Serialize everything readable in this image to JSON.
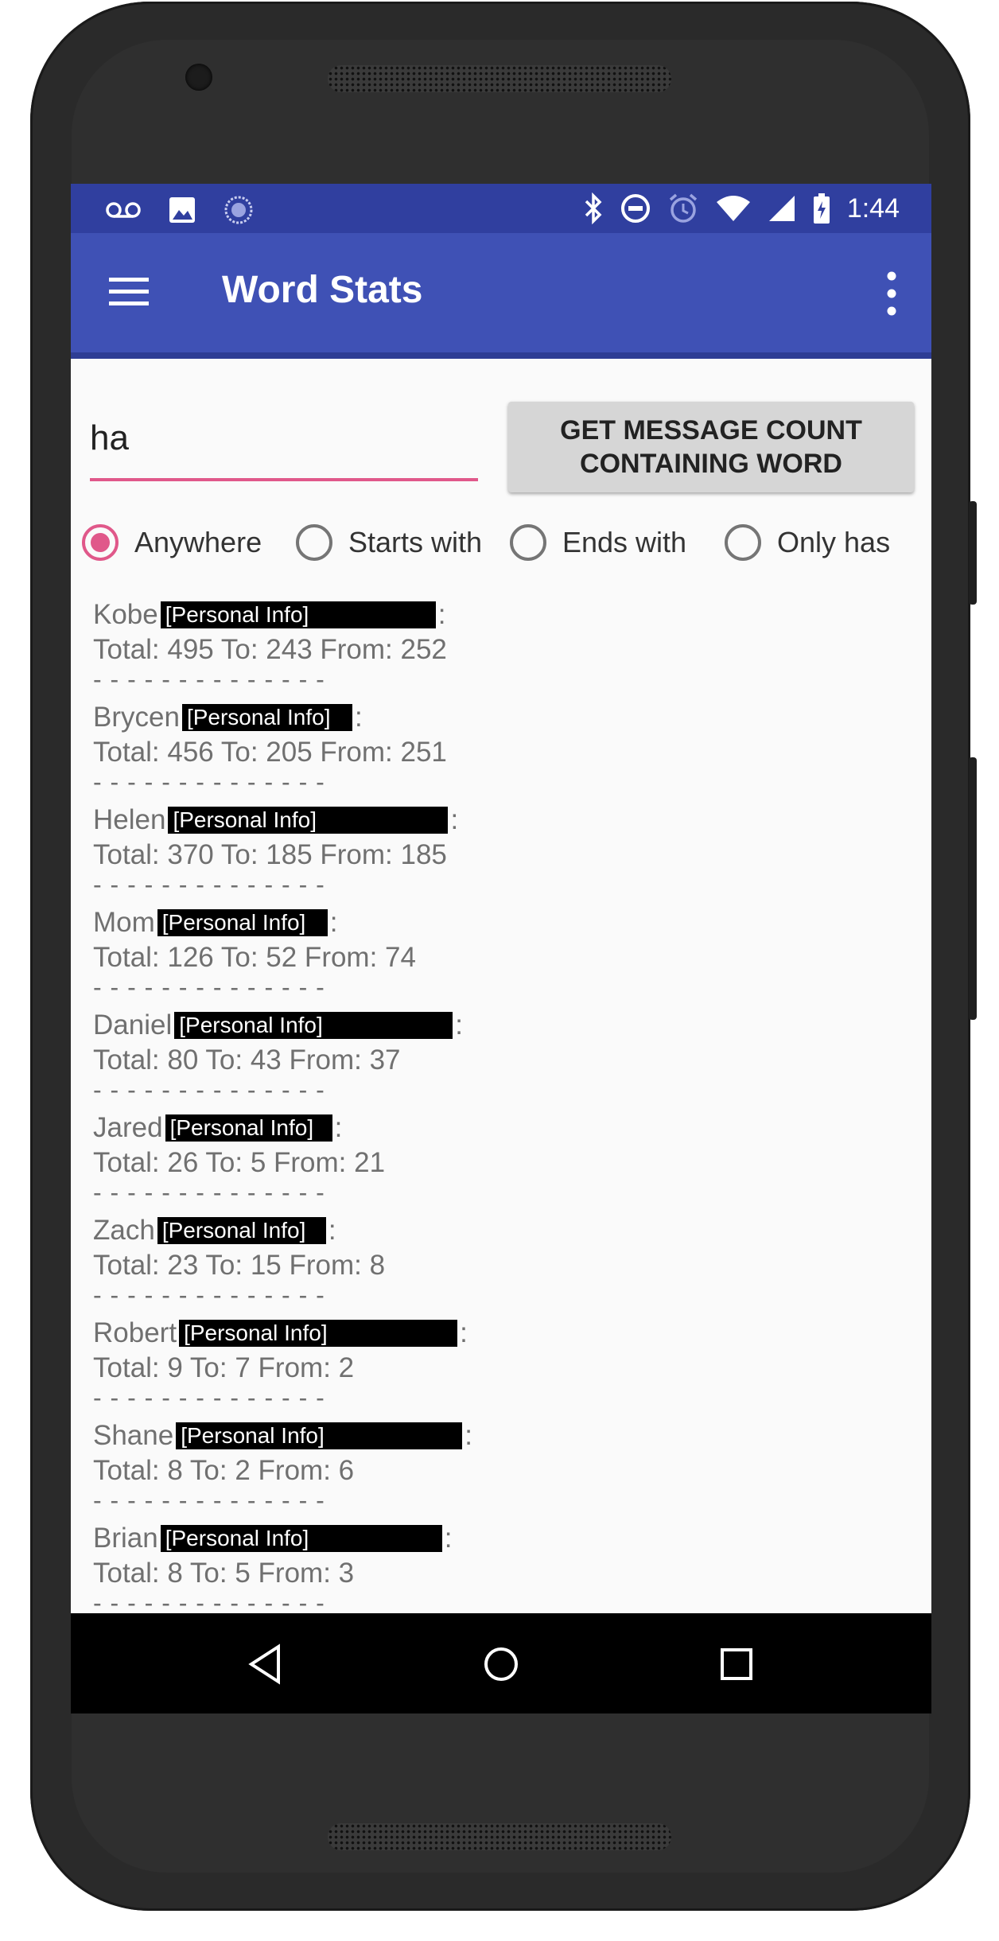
{
  "status_bar": {
    "time": "1:44",
    "left_icons": [
      "voicemail-icon",
      "image-icon",
      "sync-icon"
    ],
    "right_icons": [
      "bluetooth-icon",
      "do-not-disturb-icon",
      "alarm-icon",
      "wifi-icon",
      "signal-icon",
      "battery-icon"
    ]
  },
  "app_bar": {
    "title": "Word Stats",
    "nav_icon": "menu-icon",
    "action_icon": "overflow-menu-icon"
  },
  "search": {
    "value": "ha",
    "accent_color": "#e0588a"
  },
  "get_button": {
    "line1": "GET MESSAGE COUNT",
    "line2": "CONTAINING WORD"
  },
  "match_options": {
    "selected": "Anywhere",
    "items": [
      {
        "label": "Anywhere",
        "checked": true
      },
      {
        "label": "Starts with",
        "checked": false
      },
      {
        "label": "Ends with",
        "checked": false
      },
      {
        "label": "Only has",
        "checked": false
      }
    ]
  },
  "results": [
    {
      "name": "Kobe",
      "redacted": "[Personal Info]",
      "stats": "Total: 495 To: 243 From: 252"
    },
    {
      "name": "Brycen",
      "redacted": "[Personal Info]",
      "stats": "Total: 456 To: 205 From: 251"
    },
    {
      "name": "Helen",
      "redacted": "[Personal Info]",
      "stats": "Total: 370 To: 185 From: 185"
    },
    {
      "name": "Mom",
      "redacted": "[Personal Info]",
      "stats": "Total: 126 To: 52 From: 74"
    },
    {
      "name": "Daniel",
      "redacted": "[Personal Info]",
      "stats": "Total: 80 To: 43 From: 37"
    },
    {
      "name": "Jared",
      "redacted": "[Personal Info]",
      "stats": "Total: 26 To: 5 From: 21"
    },
    {
      "name": "Zach",
      "redacted": "[Personal Info]",
      "stats": "Total: 23 To: 15 From: 8"
    },
    {
      "name": "Robert",
      "redacted": "[Personal Info]",
      "stats": "Total: 9 To: 7 From: 2"
    },
    {
      "name": "Shane",
      "redacted": "[Personal Info]",
      "stats": "Total: 8 To: 2 From: 6"
    },
    {
      "name": "Brian",
      "redacted": "[Personal Info]",
      "stats": "Total: 8 To: 5 From: 3"
    }
  ],
  "separator": "- - - - - - - - - - - - - -",
  "name_suffix": ":",
  "nav_bar": {
    "buttons": [
      "back-icon",
      "home-icon",
      "recents-icon"
    ]
  },
  "colors": {
    "status_bar": "#303f9f",
    "app_bar": "#3f51b5",
    "accent": "#e0588a"
  }
}
